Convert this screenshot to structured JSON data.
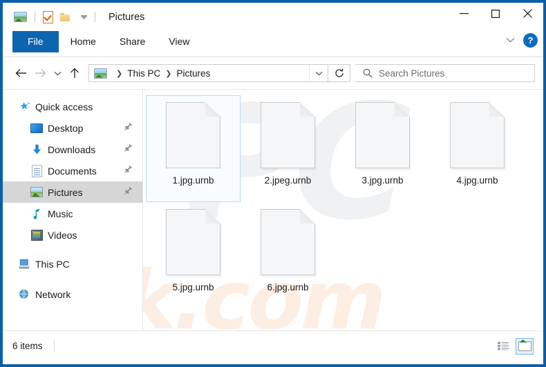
{
  "window": {
    "title": "Pictures",
    "quick_access_toolbar": [
      {
        "name": "picture-tools",
        "icon": "picture-icon"
      },
      {
        "name": "properties",
        "icon": "properties-checkmark-icon"
      },
      {
        "name": "new-folder",
        "icon": "folder-icon"
      },
      {
        "name": "customize",
        "icon": "chevron-down-icon"
      }
    ],
    "controls": {
      "minimize": "–",
      "maximize": "□",
      "close": "✕",
      "collapse_ribbon": "chevron-down-icon",
      "help": "?"
    },
    "border_color": "#0d5ea8"
  },
  "ribbon": {
    "tabs": [
      {
        "label": "File",
        "active": true
      },
      {
        "label": "Home",
        "active": false
      },
      {
        "label": "Share",
        "active": false
      },
      {
        "label": "View",
        "active": false
      }
    ],
    "accent_color": "#0d65b0"
  },
  "addressbar": {
    "back": "←",
    "forward": "→",
    "recent": "chevron-down-icon",
    "up": "↑",
    "breadcrumbs": [
      "This PC",
      "Pictures"
    ],
    "dropdown": "chevron-down-icon",
    "refresh": "refresh-icon"
  },
  "search": {
    "placeholder": "Search Pictures",
    "value": "",
    "icon": "search-icon"
  },
  "sidebar": {
    "items": [
      {
        "label": "Quick access",
        "icon": "star-icon",
        "child": false,
        "pinned": false,
        "selected": false
      },
      {
        "label": "Desktop",
        "icon": "desktop-icon",
        "child": true,
        "pinned": true,
        "selected": false
      },
      {
        "label": "Downloads",
        "icon": "download-icon",
        "child": true,
        "pinned": true,
        "selected": false
      },
      {
        "label": "Documents",
        "icon": "documents-icon",
        "child": true,
        "pinned": true,
        "selected": false
      },
      {
        "label": "Pictures",
        "icon": "pictures-icon",
        "child": true,
        "pinned": true,
        "selected": true
      },
      {
        "label": "Music",
        "icon": "music-icon",
        "child": true,
        "pinned": false,
        "selected": false
      },
      {
        "label": "Videos",
        "icon": "videos-icon",
        "child": true,
        "pinned": false,
        "selected": false
      },
      {
        "label": "This PC",
        "icon": "computer-icon",
        "child": false,
        "pinned": false,
        "selected": false
      },
      {
        "label": "Network",
        "icon": "network-icon",
        "child": false,
        "pinned": false,
        "selected": false
      }
    ],
    "selected_background": "#d6d6d6"
  },
  "files": [
    {
      "name": "1.jpg.urnb",
      "icon": "blank-document-icon",
      "selected": true
    },
    {
      "name": "2.jpeg.urnb",
      "icon": "blank-document-icon",
      "selected": false
    },
    {
      "name": "3.jpg.urnb",
      "icon": "blank-document-icon",
      "selected": false
    },
    {
      "name": "4.jpg.urnb",
      "icon": "blank-document-icon",
      "selected": false
    },
    {
      "name": "5.jpg.urnb",
      "icon": "blank-document-icon",
      "selected": false
    },
    {
      "name": "6.jpg.urnb",
      "icon": "blank-document-icon",
      "selected": false
    }
  ],
  "watermark": {
    "logo_text": "PC",
    "site_text": "risk.com",
    "logo_color": "#f0f1f2",
    "site_color": "#fdeee4"
  },
  "statusbar": {
    "item_count": "6 items",
    "views": [
      {
        "name": "details-view",
        "icon": "list-icon",
        "active": false
      },
      {
        "name": "large-icons-view",
        "icon": "thumbnail-icon",
        "active": true
      }
    ]
  }
}
